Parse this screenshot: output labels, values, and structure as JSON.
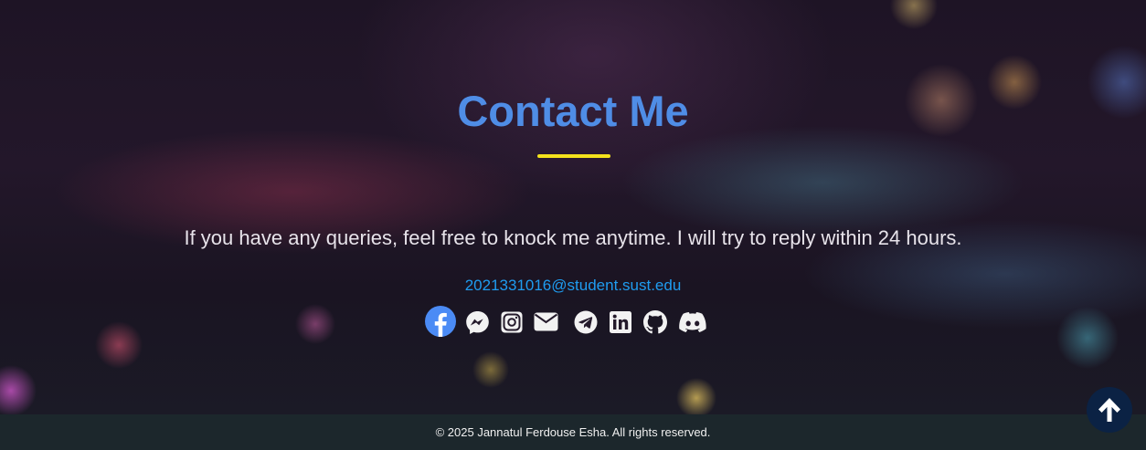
{
  "contact": {
    "title": "Contact Me",
    "tagline": "If you have any queries, feel free to knock me anytime. I will try to reply within 24 hours.",
    "email": "2021331016@student.sust.edu"
  },
  "socials": [
    {
      "icon": "facebook-icon",
      "color": "#4b8bf5"
    },
    {
      "icon": "messenger-icon",
      "color": "#f2f2f2"
    },
    {
      "icon": "instagram-icon",
      "color": "#f2f2f2"
    },
    {
      "icon": "mail-icon",
      "color": "#f2f2f2"
    },
    {
      "icon": "telegram-icon",
      "color": "#f2f2f2"
    },
    {
      "icon": "linkedin-icon",
      "color": "#f2f2f2"
    },
    {
      "icon": "github-icon",
      "color": "#f2f2f2"
    },
    {
      "icon": "discord-icon",
      "color": "#f2f2f2"
    }
  ],
  "footer": {
    "copyright": "© 2025 Jannatul Ferdouse Esha. All rights reserved."
  },
  "scroll_top": {
    "icon": "arrow-up-icon"
  },
  "colors": {
    "title": "#4f8de6",
    "underline": "#f4e21c",
    "email": "#1f9cf0",
    "footer_bg": "#1c272c",
    "scroll_button": "#0b2244"
  }
}
